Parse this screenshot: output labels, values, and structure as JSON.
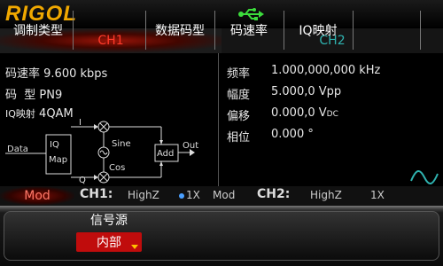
{
  "brand": "RIGOL",
  "icons": {
    "usb": "usb-icon",
    "waveform": "modulation-wave-icon"
  },
  "colors": {
    "brand": "#f0a800",
    "ch1": "#ff3b2b",
    "ch2": "#2fb3b0",
    "active": "#c00c0c"
  },
  "tabs": {
    "ch1": "CH1",
    "ch2": "CH2"
  },
  "left": {
    "rate_label": "码速率",
    "rate_value": "9.600 kbps",
    "pattern_label": "码  型",
    "pattern_value": "PN9",
    "map_label": "IQ映射",
    "map_value": "4QAM"
  },
  "diagram": {
    "data": "Data",
    "iq": "IQ",
    "map": "Map",
    "i": "I",
    "q": "Q",
    "sine": "Sine",
    "cos": "Cos",
    "add": "Add",
    "out": "Out"
  },
  "params": [
    {
      "label": "频率",
      "value": "1.000,000,000 kHz"
    },
    {
      "label": "幅度",
      "value": "5.000,0 Vpp"
    },
    {
      "label": "偏移",
      "value": "0.000,0 V",
      "sub": "DC"
    },
    {
      "label": "相位",
      "value": "0.000 °"
    }
  ],
  "status": {
    "mode": "Mod",
    "ch1": "CH1:",
    "ch1_imp": "HighZ",
    "ch1_ratio": "1X",
    "ch1_mode": "Mod",
    "ch2": "CH2:",
    "ch2_imp": "HighZ",
    "ch2_ratio": "1X"
  },
  "menu": {
    "mod_type": "调制类型",
    "source_label": "信号源",
    "source_value": "内部",
    "data_pattern": "数据码型",
    "code_rate": "码速率",
    "iq_map": "IQ映射"
  }
}
